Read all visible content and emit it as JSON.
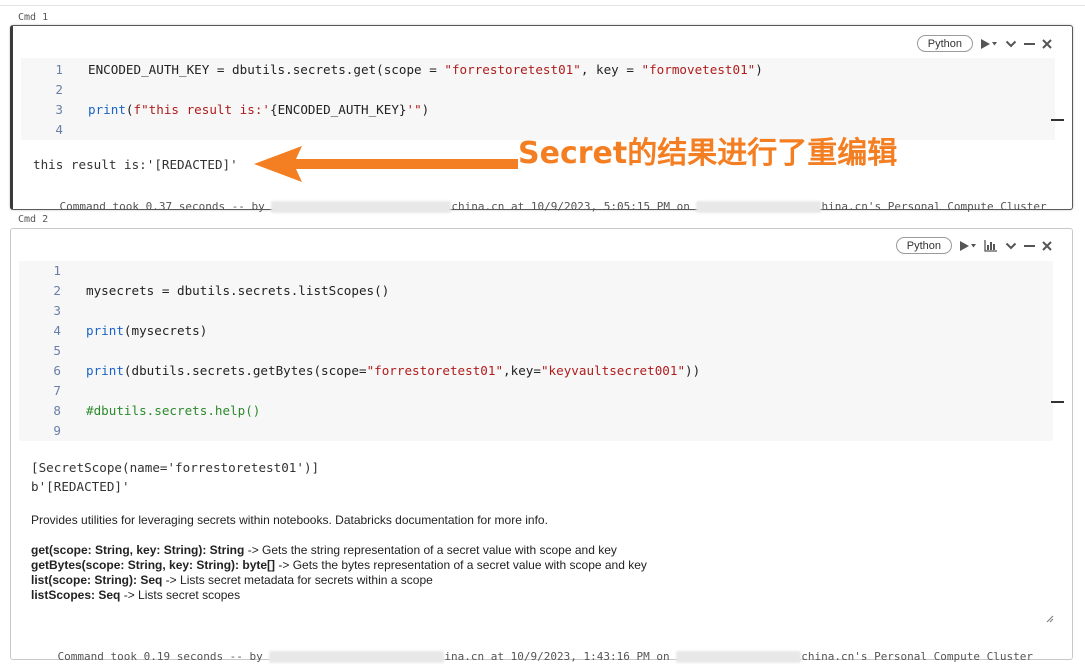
{
  "cells": [
    {
      "cmd_label": "Cmd 1",
      "language": "Python",
      "code_lines": [
        {
          "n": "1",
          "parts": [
            {
              "t": "ENCODED_AUTH_KEY = dbutils.secrets.get(scope = ",
              "c": ""
            },
            {
              "t": "\"forrestoretest01\"",
              "c": "str"
            },
            {
              "t": ", key = ",
              "c": ""
            },
            {
              "t": "\"formovetest01\"",
              "c": "str"
            },
            {
              "t": ")",
              "c": ""
            }
          ]
        },
        {
          "n": "2",
          "parts": []
        },
        {
          "n": "3",
          "parts": [
            {
              "t": "print",
              "c": "kw"
            },
            {
              "t": "(",
              "c": ""
            },
            {
              "t": "f\"this result is:'",
              "c": "str"
            },
            {
              "t": "{ENCODED_AUTH_KEY}",
              "c": ""
            },
            {
              "t": "'\"",
              "c": "str"
            },
            {
              "t": ")",
              "c": ""
            }
          ]
        },
        {
          "n": "4",
          "parts": []
        }
      ],
      "output": "this result is:'[REDACTED]'",
      "cmd_took_pre": "Command took 0.37 seconds -- by ",
      "cmd_took_mid": "china.cn at 10/9/2023, 5:05:15 PM on ",
      "cmd_took_post": "hina.cn's Personal Compute Cluster"
    },
    {
      "cmd_label": "Cmd 2",
      "language": "Python",
      "code_lines": [
        {
          "n": "1",
          "parts": []
        },
        {
          "n": "2",
          "parts": [
            {
              "t": "mysecrets = dbutils.secrets.listScopes()",
              "c": ""
            }
          ]
        },
        {
          "n": "3",
          "parts": []
        },
        {
          "n": "4",
          "parts": [
            {
              "t": "print",
              "c": "kw"
            },
            {
              "t": "(mysecrets)",
              "c": ""
            }
          ]
        },
        {
          "n": "5",
          "parts": []
        },
        {
          "n": "6",
          "parts": [
            {
              "t": "print",
              "c": "kw"
            },
            {
              "t": "(dbutils.secrets.getBytes(scope=",
              "c": ""
            },
            {
              "t": "\"forrestoretest01\"",
              "c": "str"
            },
            {
              "t": ",key=",
              "c": ""
            },
            {
              "t": "\"keyvaultsecret001\"",
              "c": "str"
            },
            {
              "t": "))",
              "c": ""
            }
          ]
        },
        {
          "n": "7",
          "parts": []
        },
        {
          "n": "8",
          "parts": [
            {
              "t": "#dbutils.secrets.help()",
              "c": "cmt"
            }
          ]
        },
        {
          "n": "9",
          "parts": []
        }
      ],
      "output_lines": [
        "[SecretScope(name='forrestoretest01')]",
        "b'[REDACTED]'"
      ],
      "doc_intro": "Provides utilities for leveraging secrets within notebooks. Databricks documentation for more info.",
      "doc_methods": [
        {
          "sig": "get(scope: String, key: String): String",
          "desc": " -> Gets the string representation of a secret value with scope and key"
        },
        {
          "sig": "getBytes(scope: String, key: String): byte[]",
          "desc": " -> Gets the bytes representation of a secret value with scope and key"
        },
        {
          "sig": "list(scope: String): Seq",
          "desc": " -> Lists secret metadata for secrets within a scope"
        },
        {
          "sig": "listScopes: Seq",
          "desc": " -> Lists secret scopes"
        }
      ],
      "cmd_took_pre": "Command took 0.19 seconds -- by ",
      "cmd_took_mid": "ina.cn at 10/9/2023, 1:43:16 PM on ",
      "cmd_took_post": "china.cn's Personal Compute Cluster"
    }
  ],
  "annotation": {
    "text": "Secret的结果进行了重编辑",
    "color": "#f47f23"
  },
  "icons": [
    "run-icon",
    "dropdown-icon",
    "chart-icon",
    "collapse-icon",
    "minimize-icon",
    "close-icon"
  ]
}
